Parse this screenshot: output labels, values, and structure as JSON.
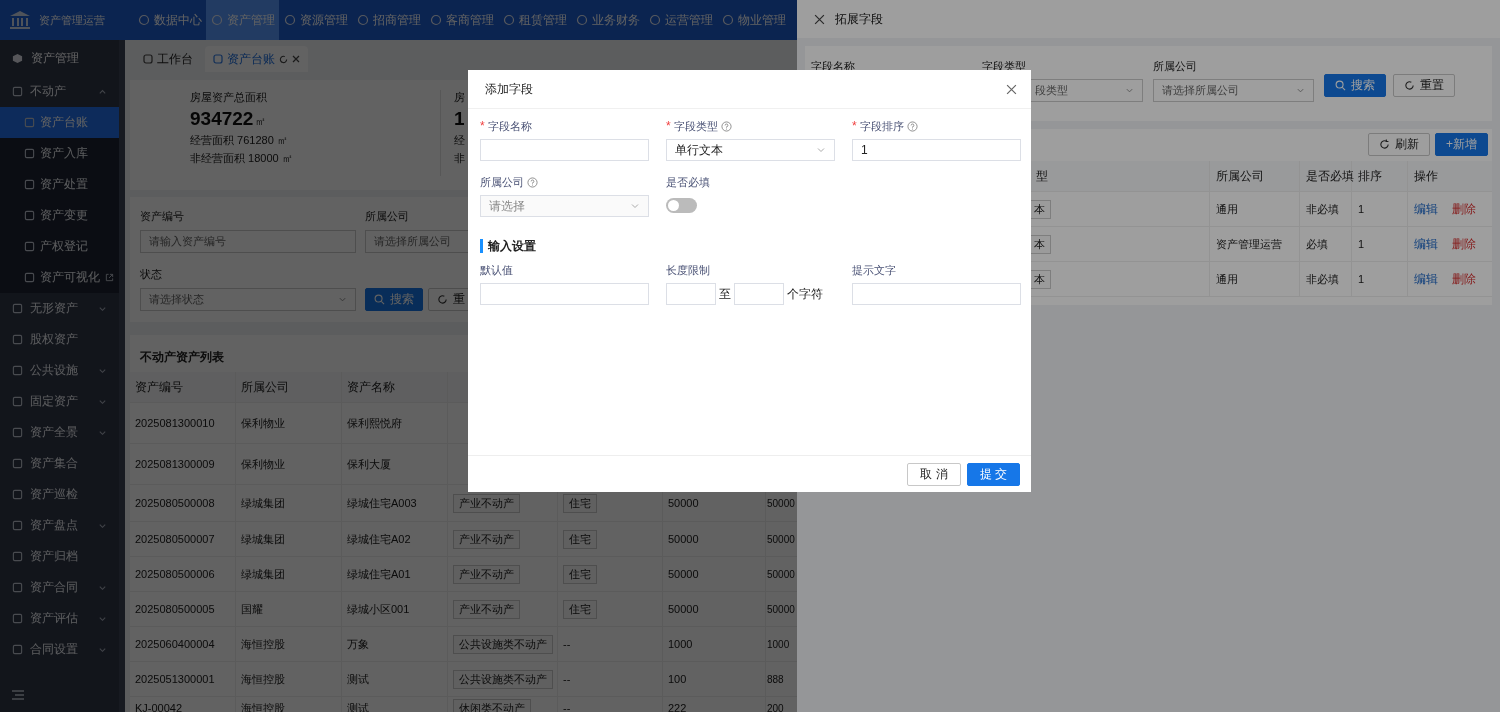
{
  "top_nav": {
    "logo_text": "资产管理运营",
    "items": [
      {
        "label": "数据中心",
        "selected": false
      },
      {
        "label": "资产管理",
        "selected": true
      },
      {
        "label": "资源管理",
        "selected": false
      },
      {
        "label": "招商管理",
        "selected": false
      },
      {
        "label": "客商管理",
        "selected": false
      },
      {
        "label": "租赁管理",
        "selected": false
      },
      {
        "label": "业务财务",
        "selected": false
      },
      {
        "label": "运营管理",
        "selected": false
      },
      {
        "label": "物业管理",
        "selected": false
      }
    ]
  },
  "sidebar": {
    "header": "资产管理",
    "items": [
      {
        "label": "不动产",
        "kind": "group",
        "expanded": true,
        "children": [
          {
            "label": "资产台账",
            "selected": true,
            "external": false
          },
          {
            "label": "资产入库",
            "selected": false,
            "external": false
          },
          {
            "label": "资产处置",
            "selected": false,
            "external": false
          },
          {
            "label": "资产变更",
            "selected": false,
            "external": false
          },
          {
            "label": "产权登记",
            "selected": false,
            "external": false
          },
          {
            "label": "资产可视化",
            "selected": false,
            "external": true
          }
        ]
      },
      {
        "label": "无形资产",
        "kind": "group",
        "expanded": false
      },
      {
        "label": "股权资产",
        "kind": "link"
      },
      {
        "label": "公共设施",
        "kind": "group",
        "expanded": false
      },
      {
        "label": "固定资产",
        "kind": "group",
        "expanded": false
      },
      {
        "label": "资产全景",
        "kind": "group",
        "expanded": false
      },
      {
        "label": "资产集合",
        "kind": "link"
      },
      {
        "label": "资产巡检",
        "kind": "link"
      },
      {
        "label": "资产盘点",
        "kind": "group",
        "expanded": false
      },
      {
        "label": "资产归档",
        "kind": "link"
      },
      {
        "label": "资产合同",
        "kind": "group",
        "expanded": false
      },
      {
        "label": "资产评估",
        "kind": "group",
        "expanded": false
      },
      {
        "label": "合同设置",
        "kind": "group",
        "expanded": false
      }
    ]
  },
  "tabs": [
    {
      "label": "工作台",
      "selected": false
    },
    {
      "label": "资产台账",
      "selected": true
    }
  ],
  "stats": [
    {
      "title": "房屋资产总面积",
      "value": "934722",
      "unit": "㎡",
      "lines": [
        "经营面积 761280 ㎡",
        "非经营面积 18000 ㎡"
      ]
    },
    {
      "title": "房",
      "value": "1",
      "lines": [
        "经",
        "非"
      ]
    }
  ],
  "filters": {
    "fields": [
      {
        "label": "资产编号",
        "placeholder": "请输入资产编号",
        "kind": "input"
      },
      {
        "label": "所属公司",
        "placeholder": "请选择所属公司",
        "kind": "select"
      },
      {
        "label": "状态",
        "placeholder": "请选择状态",
        "kind": "select"
      }
    ],
    "search": "搜索",
    "reset": "重"
  },
  "table": {
    "title": "不动产资产列表",
    "columns": [
      "资产编号",
      "所属公司",
      "资产名称"
    ],
    "rows": [
      {
        "code": "2025081300010",
        "company": "保利物业",
        "name": "保利熙悦府"
      },
      {
        "code": "2025081300009",
        "company": "保利物业",
        "name": "保利大厦"
      },
      {
        "code": "2025080500008",
        "company": "绿城集团",
        "name": "绿城住宅A003",
        "type": "产业不动产",
        "use": "住宅",
        "area": "50000",
        "area2": "50000"
      },
      {
        "code": "2025080500007",
        "company": "绿城集团",
        "name": "绿城住宅A02",
        "type": "产业不动产",
        "use": "住宅",
        "area": "50000",
        "area2": "50000"
      },
      {
        "code": "2025080500006",
        "company": "绿城集团",
        "name": "绿城住宅A01",
        "type": "产业不动产",
        "use": "住宅",
        "area": "50000",
        "area2": "50000"
      },
      {
        "code": "2025080500005",
        "company": "国耀",
        "name": "绿城小区001",
        "type": "产业不动产",
        "use": "住宅",
        "area": "50000",
        "area2": "50000"
      },
      {
        "code": "2025060400004",
        "company": "海恒控股",
        "name": "万象",
        "type": "公共设施类不动产",
        "use": "--",
        "area": "1000",
        "area2": "1000"
      },
      {
        "code": "2025051300001",
        "company": "海恒控股",
        "name": "测试",
        "type": "公共设施类不动产",
        "use": "--",
        "area": "100",
        "area2": "888"
      },
      {
        "code": "KJ-00042",
        "company": "海恒控股",
        "name": "测试",
        "type": "休闲类不动产",
        "use": "--",
        "area": "222",
        "area2": "200"
      }
    ]
  },
  "drawer": {
    "title": "拓展字段",
    "filters": [
      {
        "label": "字段名称"
      },
      {
        "label": "字段类型",
        "placeholder": "段类型"
      },
      {
        "label": "所属公司",
        "placeholder": "请选择所属公司"
      }
    ],
    "search": "搜索",
    "reset": "重置",
    "refresh": "刷新",
    "add": "+新增",
    "columns": [
      "型",
      "所属公司",
      "是否必填",
      "排序",
      "操作"
    ],
    "rows": [
      {
        "type": "本",
        "company": "通用",
        "required": "非必填",
        "order": "1",
        "edit": "编辑",
        "delete": "删除"
      },
      {
        "type": "本",
        "company": "资产管理运营",
        "required": "必填",
        "order": "1",
        "edit": "编辑",
        "delete": "删除"
      },
      {
        "type": "本",
        "company": "通用",
        "required": "非必填",
        "order": "1",
        "edit": "编辑",
        "delete": "删除"
      }
    ]
  },
  "modal": {
    "title": "添加字段",
    "required_mark": "*",
    "fields": [
      {
        "label": "字段名称",
        "required": true,
        "help": false,
        "kind": "input"
      },
      {
        "label": "字段类型",
        "required": true,
        "help": true,
        "kind": "select",
        "value": "单行文本"
      },
      {
        "label": "字段排序",
        "required": true,
        "help": true,
        "kind": "input",
        "value": "1"
      },
      {
        "label": "所属公司",
        "required": false,
        "help": true,
        "kind": "select",
        "placeholder": "请选择"
      },
      {
        "label": "是否必填",
        "required": false,
        "help": false,
        "kind": "switch",
        "on": false
      }
    ],
    "section_title": "输入设置",
    "input_settings": {
      "default_label": "默认值",
      "length_label": "长度限制",
      "length_to": "至",
      "length_unit": "个字符",
      "hint_label": "提示文字"
    },
    "cancel": "取 消",
    "submit": "提 交"
  }
}
